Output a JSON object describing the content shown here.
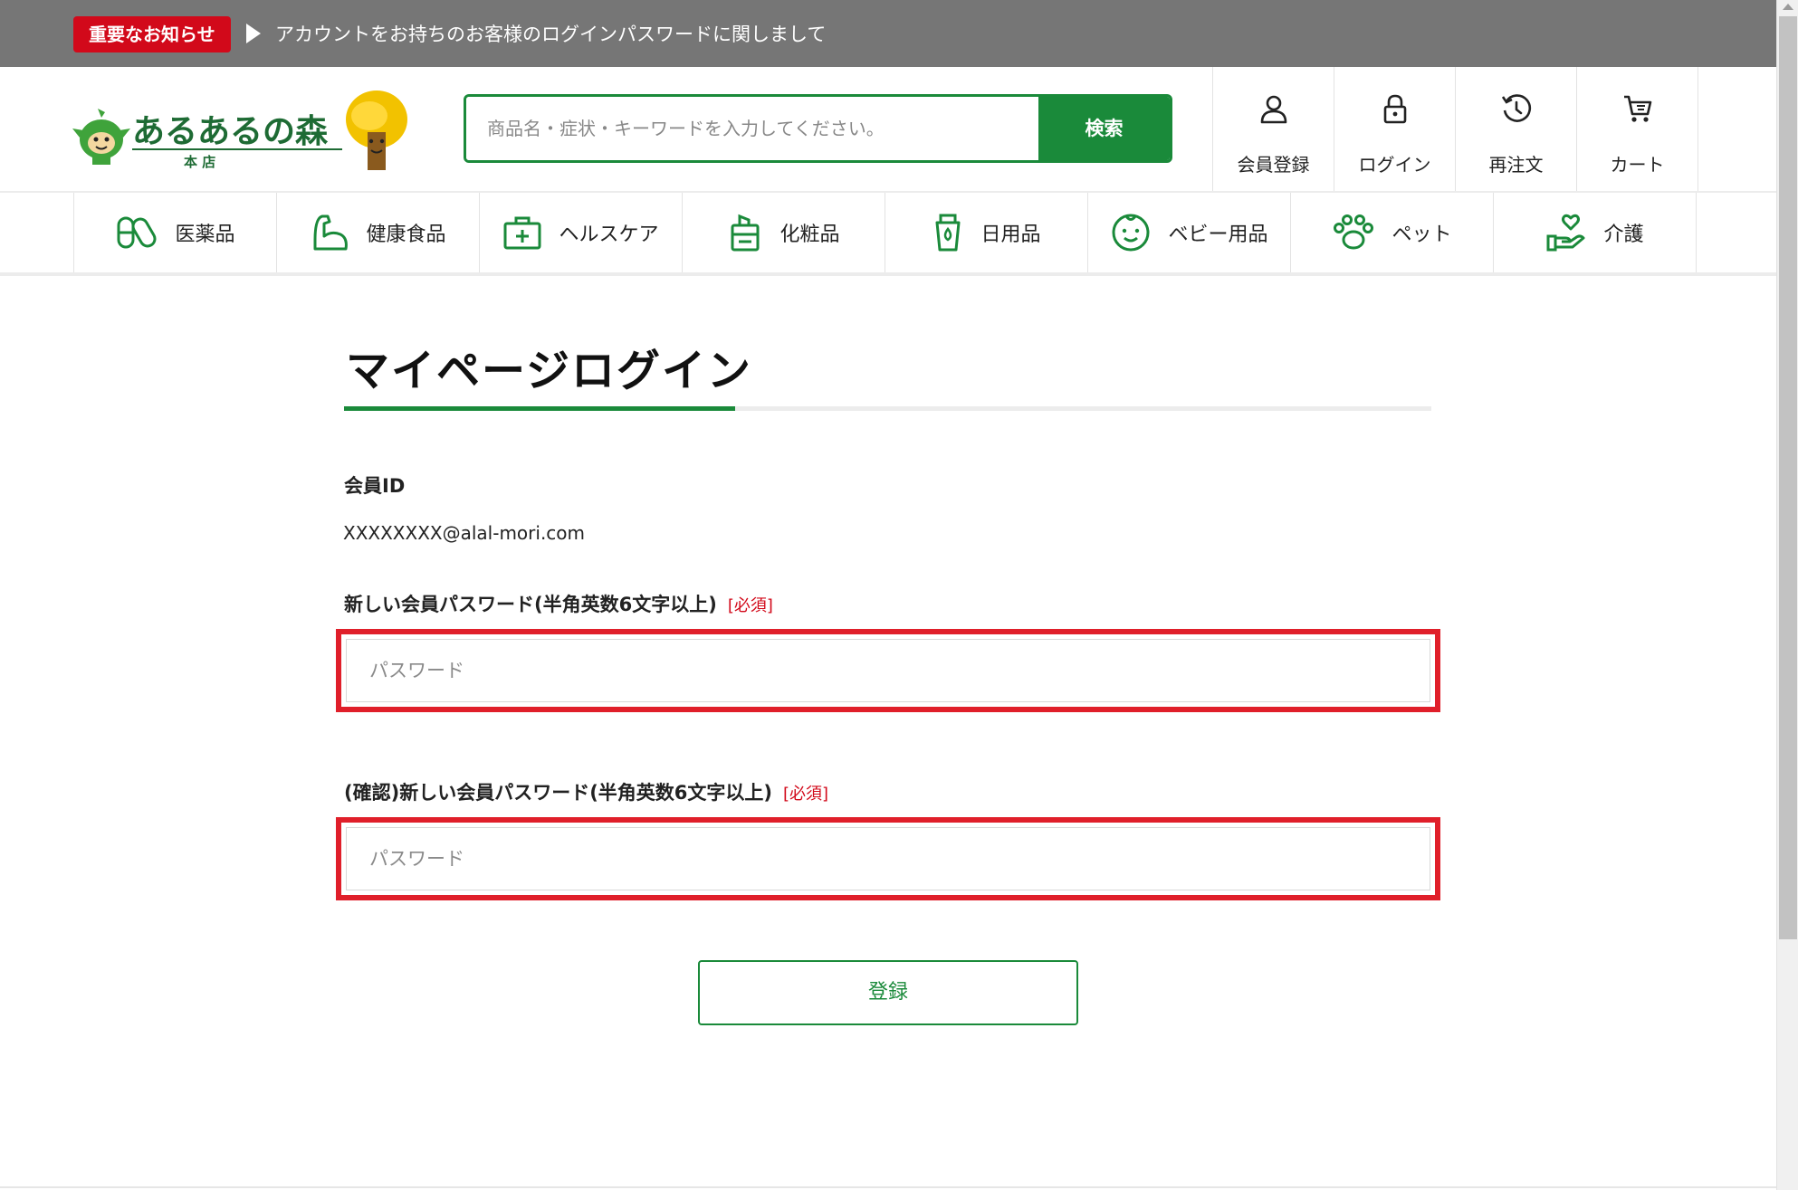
{
  "notice": {
    "badge": "重要なお知らせ",
    "text": "アカウントをお持ちのお客様のログインパスワードに関しまして"
  },
  "header": {
    "logo_text": "あるあるの森",
    "logo_sub": "本 店",
    "search_placeholder": "商品名・症状・キーワードを入力してください。",
    "search_button": "検索",
    "utilities": [
      {
        "label": "会員登録",
        "icon": "user-icon"
      },
      {
        "label": "ログイン",
        "icon": "lock-icon"
      },
      {
        "label": "再注文",
        "icon": "history-icon"
      },
      {
        "label": "カート",
        "icon": "cart-icon"
      }
    ]
  },
  "categories": [
    {
      "label": "医薬品",
      "icon": "pills-icon"
    },
    {
      "label": "健康食品",
      "icon": "muscle-icon"
    },
    {
      "label": "ヘルスケア",
      "icon": "first-aid-icon"
    },
    {
      "label": "化粧品",
      "icon": "cosmetics-icon"
    },
    {
      "label": "日用品",
      "icon": "bottle-icon"
    },
    {
      "label": "ベビー用品",
      "icon": "baby-face-icon"
    },
    {
      "label": "ペット",
      "icon": "paw-icon"
    },
    {
      "label": "介護",
      "icon": "care-hand-icon"
    }
  ],
  "main": {
    "title": "マイページログイン",
    "member_id_label": "会員ID",
    "member_id_value": "XXXXXXXX@alal-mori.com",
    "new_password_label": "新しい会員パスワード(半角英数6文字以上)",
    "confirm_password_label": "(確認)新しい会員パスワード(半角英数6文字以上)",
    "required_tag": "[必須]",
    "password_placeholder": "パスワード",
    "submit_label": "登録"
  },
  "colors": {
    "brand_green": "#1a8a3a",
    "notice_red": "#d2091a",
    "highlight_red": "#e01f2a",
    "notice_bar": "#767676"
  }
}
